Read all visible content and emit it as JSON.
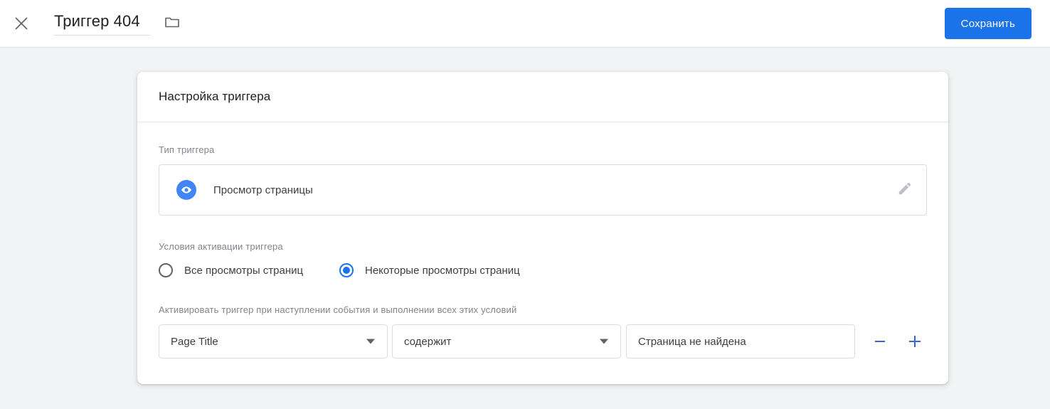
{
  "topbar": {
    "close_icon": "close-icon",
    "trigger_title": "Триггер 404",
    "folder_icon": "folder-icon",
    "save_label": "Сохранить",
    "accent_color": "#1a73e8"
  },
  "card": {
    "header_title": "Настройка триггера",
    "type_section": {
      "label": "Тип триггера",
      "icon": "eye-icon",
      "icon_color": "#4285f4",
      "name": "Просмотр страницы",
      "edit_icon": "pencil-icon"
    },
    "conditions_section": {
      "label": "Условия активации триггера",
      "options": [
        {
          "label": "Все просмотры страниц",
          "selected": false
        },
        {
          "label": "Некоторые просмотры страниц",
          "selected": true
        }
      ]
    },
    "filters_section": {
      "label": "Активировать триггер при наступлении события и выполнении всех этих условий",
      "variable": "Page Title",
      "operator": "содержит",
      "value": "Страница не найдена",
      "remove_icon": "minus-icon",
      "add_icon": "plus-icon"
    }
  }
}
